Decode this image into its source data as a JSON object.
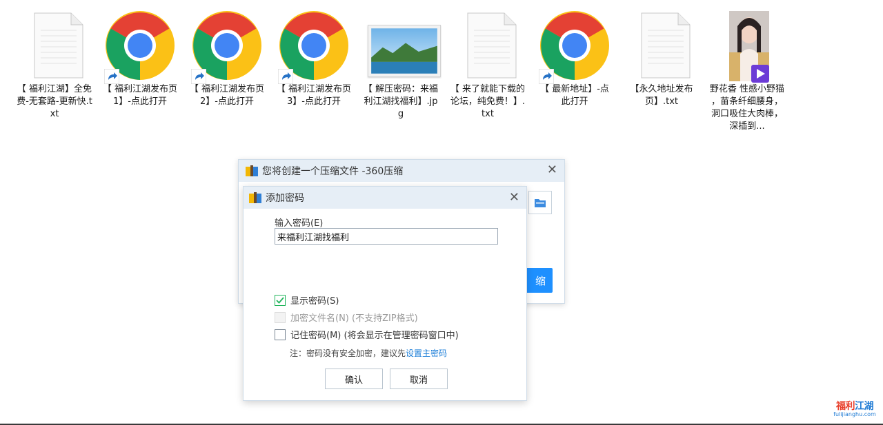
{
  "desktop": {
    "icons": [
      {
        "label": "【 福利江湖】全免费-无套路-更新快.txt",
        "icon": "text-file-icon"
      },
      {
        "label": "【 福利江湖发布页1】-点此打开",
        "icon": "chrome-shortcut-icon"
      },
      {
        "label": "【 福利江湖发布页2】-点此打开",
        "icon": "chrome-shortcut-icon"
      },
      {
        "label": "【 福利江湖发布页3】-点此打开",
        "icon": "chrome-shortcut-icon"
      },
      {
        "label": "【 解压密码：来福利江湖找福利】.jpg",
        "icon": "image-file-icon"
      },
      {
        "label": "【 来了就能下载的论坛，纯免费！】.txt",
        "icon": "text-file-icon"
      },
      {
        "label": "【 最新地址】-点此打开",
        "icon": "chrome-shortcut-icon"
      },
      {
        "label": "【永久地址发布页】.txt",
        "icon": "text-file-icon"
      },
      {
        "label": "野花香 性感小野猫 ，苗条纤细腰身，洞口吸住大肉棒，深插到...",
        "icon": "video-file-icon"
      }
    ]
  },
  "main_dialog": {
    "title": "您将创建一个压缩文件 -360压缩",
    "close": "✕",
    "compress_button": "缩"
  },
  "password_dialog": {
    "title": "添加密码",
    "close": "✕",
    "input_label": "输入密码(E)",
    "input_value": "来福利江湖找福利",
    "show_password": "显示密码(S)",
    "encrypt_filename": "加密文件名(N) (不支持ZIP格式)",
    "remember_password": "记住密码(M) (将会显示在管理密码窗口中)",
    "note_prefix": "注：密码没有安全加密，建议先",
    "note_link": "设置主密码",
    "ok": "确认",
    "cancel": "取消",
    "checks": {
      "show_password": true,
      "encrypt_filename": false,
      "remember_password": false
    }
  },
  "watermark": {
    "brand_a": "福利",
    "brand_b": "江湖",
    "domain": "fulijianghu.com"
  },
  "colors": {
    "accent": "#1e90ff",
    "titlebar": "#e6eef6",
    "check": "#1fb45a",
    "link": "#1e7fd8"
  }
}
